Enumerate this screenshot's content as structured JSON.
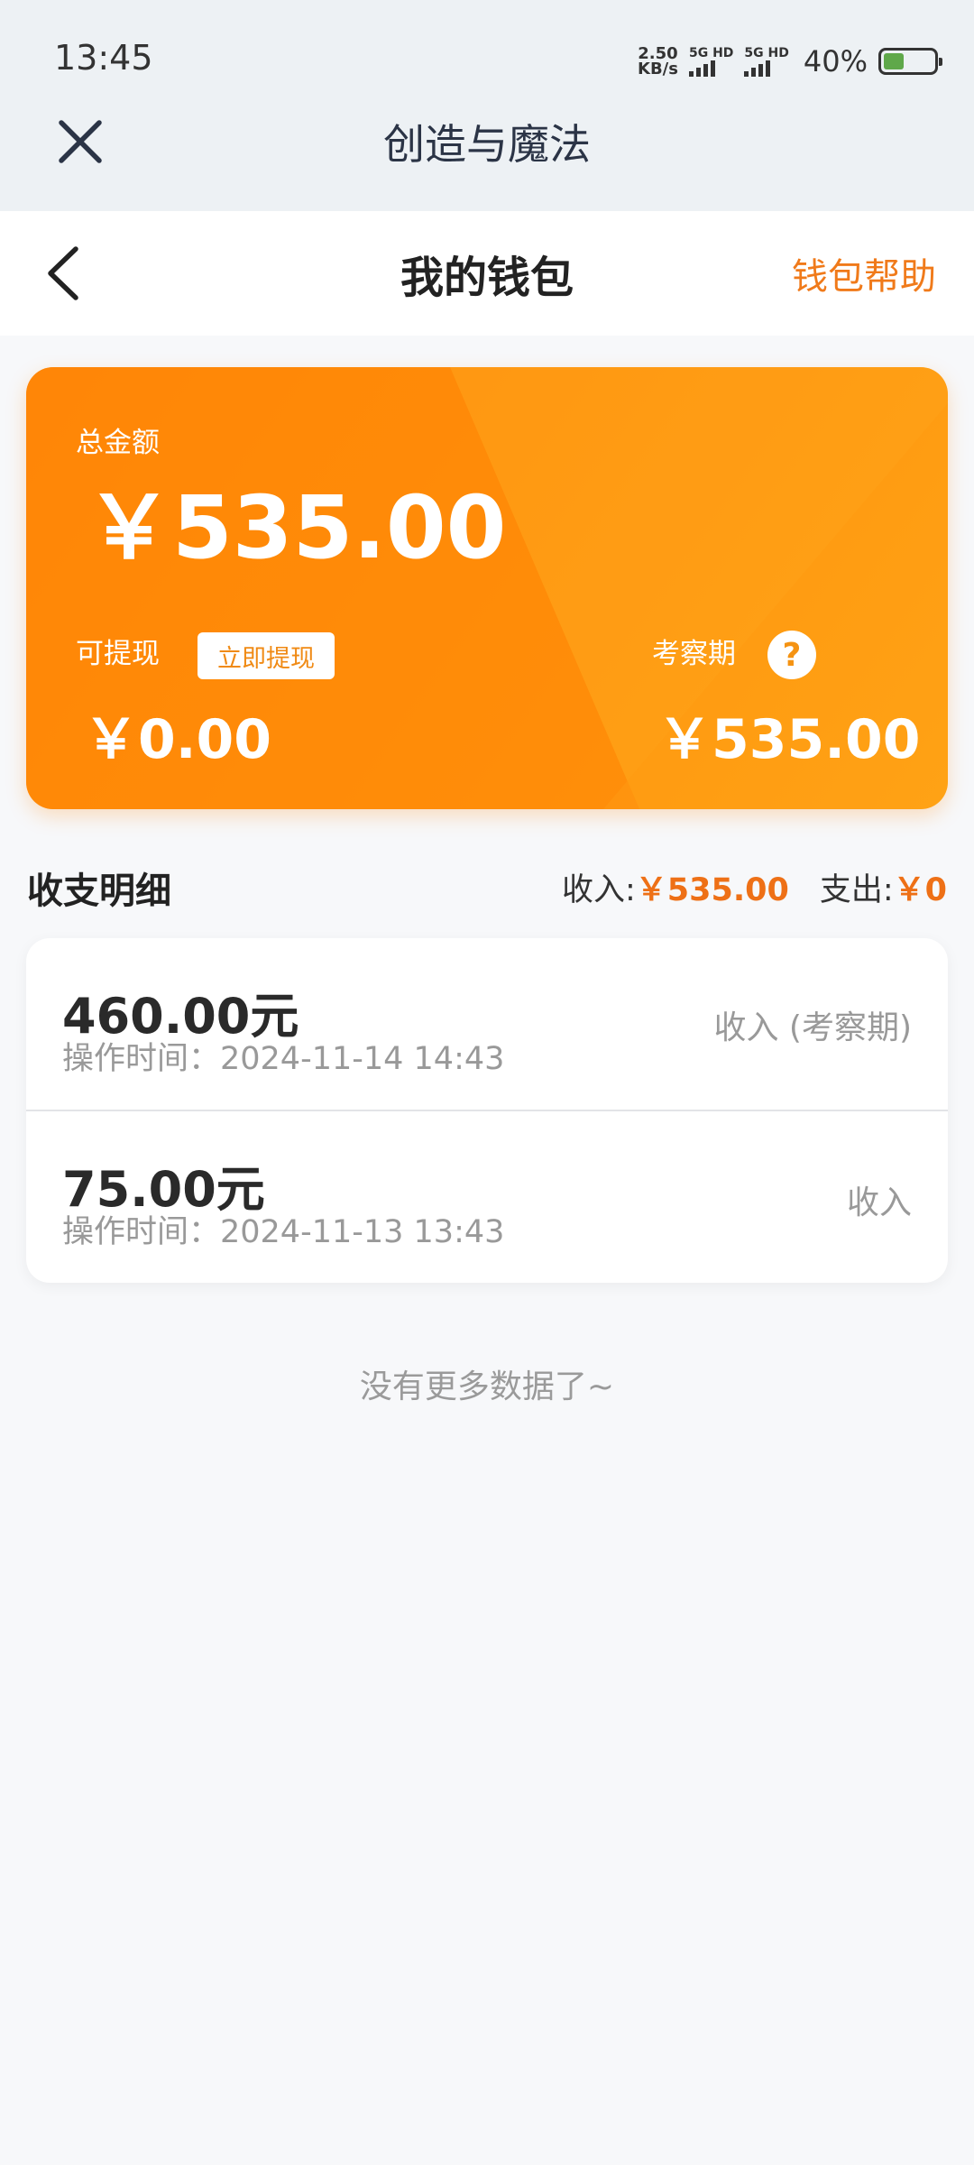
{
  "status": {
    "time": "13:45",
    "net_speed_value": "2.50",
    "net_speed_unit": "KB/s",
    "sim1": "5G HD",
    "sim2": "5G HD",
    "battery": "40%",
    "battery_level": 0.4
  },
  "app": {
    "title": "创造与魔法"
  },
  "nav": {
    "title": "我的钱包",
    "help": "钱包帮助"
  },
  "wallet": {
    "total_label": "总金额",
    "total_value": "￥535.00",
    "withdrawable_label": "可提现",
    "withdraw_button": "立即提现",
    "withdrawable_value": "￥0.00",
    "probation_label": "考察期",
    "probation_help": "?",
    "probation_value": "￥535.00"
  },
  "details": {
    "title": "收支明细",
    "income_label": "收入:",
    "income_value": "￥535.00",
    "expense_label": "支出:",
    "expense_value": "￥0"
  },
  "transactions": [
    {
      "amount": "460.00元",
      "time": "操作时间：2024-11-14 14:43",
      "type": "收入 (考察期)"
    },
    {
      "amount": "75.00元",
      "time": "操作时间：2024-11-13 13:43",
      "type": "收入"
    }
  ],
  "footer": {
    "no_more": "没有更多数据了~"
  },
  "colors": {
    "accent": "#f07a1a",
    "card_start": "#ff8a0c",
    "card_end": "#ffa215"
  }
}
